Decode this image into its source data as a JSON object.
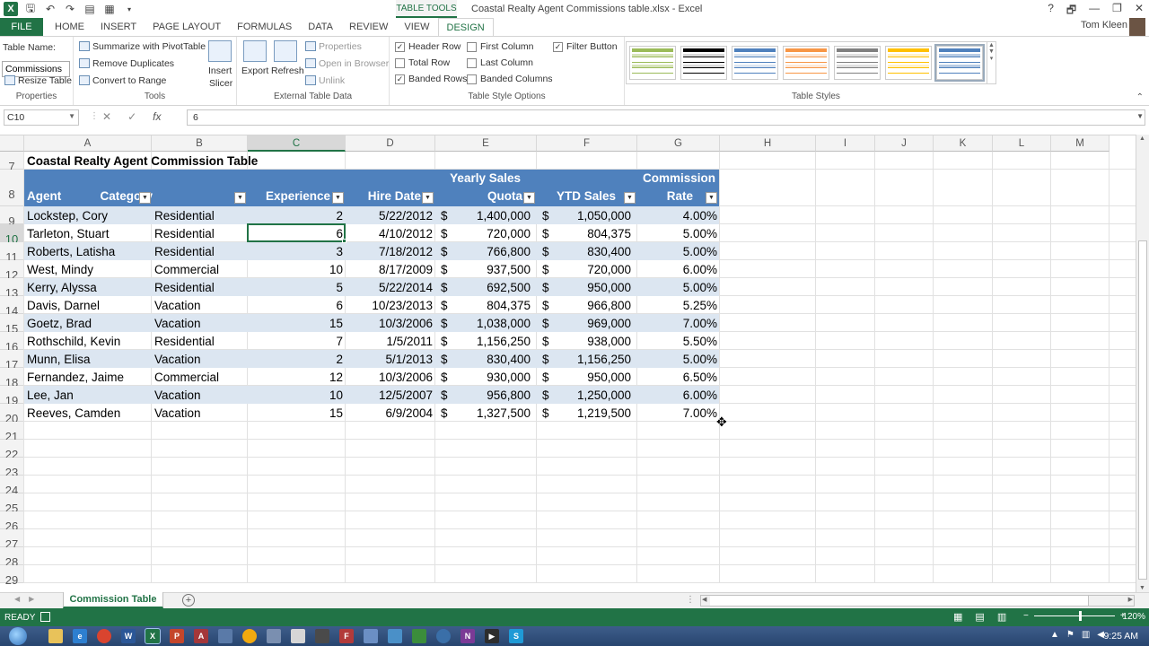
{
  "window": {
    "title": "Coastal Realty Agent Commissions table.xlsx - Excel",
    "table_tools": "TABLE TOOLS",
    "user": "Tom Kleen",
    "help": "?",
    "controls": [
      "🗗",
      "—",
      "❐",
      "✕"
    ]
  },
  "ribbon_tabs": [
    "FILE",
    "HOME",
    "INSERT",
    "PAGE LAYOUT",
    "FORMULAS",
    "DATA",
    "REVIEW",
    "VIEW",
    "DESIGN"
  ],
  "ribbon": {
    "properties": {
      "table_name_label": "Table Name:",
      "table_name_value": "Commissions",
      "resize": "Resize Table",
      "group": "Properties"
    },
    "tools": {
      "pivot": "Summarize with PivotTable",
      "remove_dup": "Remove Duplicates",
      "convert": "Convert to Range",
      "insert_slicer_1": "Insert",
      "insert_slicer_2": "Slicer",
      "group": "Tools"
    },
    "external": {
      "export": "Export",
      "refresh": "Refresh",
      "properties": "Properties",
      "open_browser": "Open in Browser",
      "unlink": "Unlink",
      "group": "External Table Data"
    },
    "style_options": {
      "header_row": "Header Row",
      "total_row": "Total Row",
      "banded_rows": "Banded Rows",
      "first_column": "First Column",
      "last_column": "Last Column",
      "banded_columns": "Banded Columns",
      "filter_button": "Filter Button",
      "group": "Table Style Options"
    },
    "styles": {
      "group": "Table Styles",
      "swatches": [
        {
          "head": "#ffffff",
          "band": "#d8e4bc",
          "line": "#9bbb59"
        },
        {
          "head": "#000000",
          "band": "#d9d9d9",
          "line": "#000000"
        },
        {
          "head": "#ffffff",
          "band": "#dce6f1",
          "line": "#4f81bd"
        },
        {
          "head": "#ffffff",
          "band": "#fde9d9",
          "line": "#f79646"
        },
        {
          "head": "#ffffff",
          "band": "#e0e0e0",
          "line": "#808080"
        },
        {
          "head": "#ffffff",
          "band": "#fff2cc",
          "line": "#ffc000"
        },
        {
          "head": "#4f81bd",
          "band": "#b8cce4",
          "line": "#4f81bd"
        }
      ]
    }
  },
  "formula_bar": {
    "name_box": "C10",
    "content": "6",
    "cancel_icon": "✕",
    "enter_icon": "✓",
    "fx_icon": "fx"
  },
  "columns": [
    "A",
    "B",
    "C",
    "D",
    "E",
    "F",
    "G",
    "H",
    "I",
    "J",
    "K",
    "L",
    "M"
  ],
  "rows": [
    "7",
    "8",
    "9",
    "10",
    "11",
    "12",
    "13",
    "14",
    "15",
    "16",
    "17",
    "18",
    "19",
    "20",
    "21",
    "22",
    "23",
    "24",
    "25",
    "26",
    "27",
    "28",
    "29"
  ],
  "sheet": {
    "title": "Coastal Realty Agent Commission Table",
    "headers": {
      "agent": "Agent",
      "category": "Category",
      "experience": "Experience",
      "hire_date": "Hire Date",
      "quota_top": "Yearly Sales",
      "quota": "Quota",
      "ytd": "YTD Sales",
      "rate_top": "Commission",
      "rate": "Rate"
    },
    "currency": "$",
    "data": [
      [
        "Lockstep, Cory",
        "Residential",
        "2",
        "5/22/2012",
        "1,400,000",
        "1,050,000",
        "4.00%"
      ],
      [
        "Tarleton, Stuart",
        "Residential",
        "6",
        "4/10/2012",
        "720,000",
        "804,375",
        "5.00%"
      ],
      [
        "Roberts, Latisha",
        "Residential",
        "3",
        "7/18/2012",
        "766,800",
        "830,400",
        "5.00%"
      ],
      [
        "West, Mindy",
        "Commercial",
        "10",
        "8/17/2009",
        "937,500",
        "720,000",
        "6.00%"
      ],
      [
        "Kerry, Alyssa",
        "Residential",
        "5",
        "5/22/2014",
        "692,500",
        "950,000",
        "5.00%"
      ],
      [
        "Davis, Darnel",
        "Vacation",
        "6",
        "10/23/2013",
        "804,375",
        "966,800",
        "5.25%"
      ],
      [
        "Goetz, Brad",
        "Vacation",
        "15",
        "10/3/2006",
        "1,038,000",
        "969,000",
        "7.00%"
      ],
      [
        "Rothschild, Kevin",
        "Residential",
        "7",
        "1/5/2011",
        "1,156,250",
        "938,000",
        "5.50%"
      ],
      [
        "Munn, Elisa",
        "Vacation",
        "2",
        "5/1/2013",
        "830,400",
        "1,156,250",
        "5.00%"
      ],
      [
        "Fernandez, Jaime",
        "Commercial",
        "12",
        "10/3/2006",
        "930,000",
        "950,000",
        "6.50%"
      ],
      [
        "Lee, Jan",
        "Vacation",
        "10",
        "12/5/2007",
        "956,800",
        "1,250,000",
        "6.00%"
      ],
      [
        "Reeves, Camden",
        "Vacation",
        "15",
        "6/9/2004",
        "1,327,500",
        "1,219,500",
        "7.00%"
      ]
    ]
  },
  "sheet_tab": "Commission Table",
  "status": {
    "mode": "READY",
    "zoom": "120%",
    "minus": "−",
    "plus": "+"
  },
  "taskbar": {
    "time": "9:25 AM"
  },
  "colors": {
    "excel_green": "#217346",
    "table_header": "#4f81bd",
    "band": "#dce6f1"
  }
}
